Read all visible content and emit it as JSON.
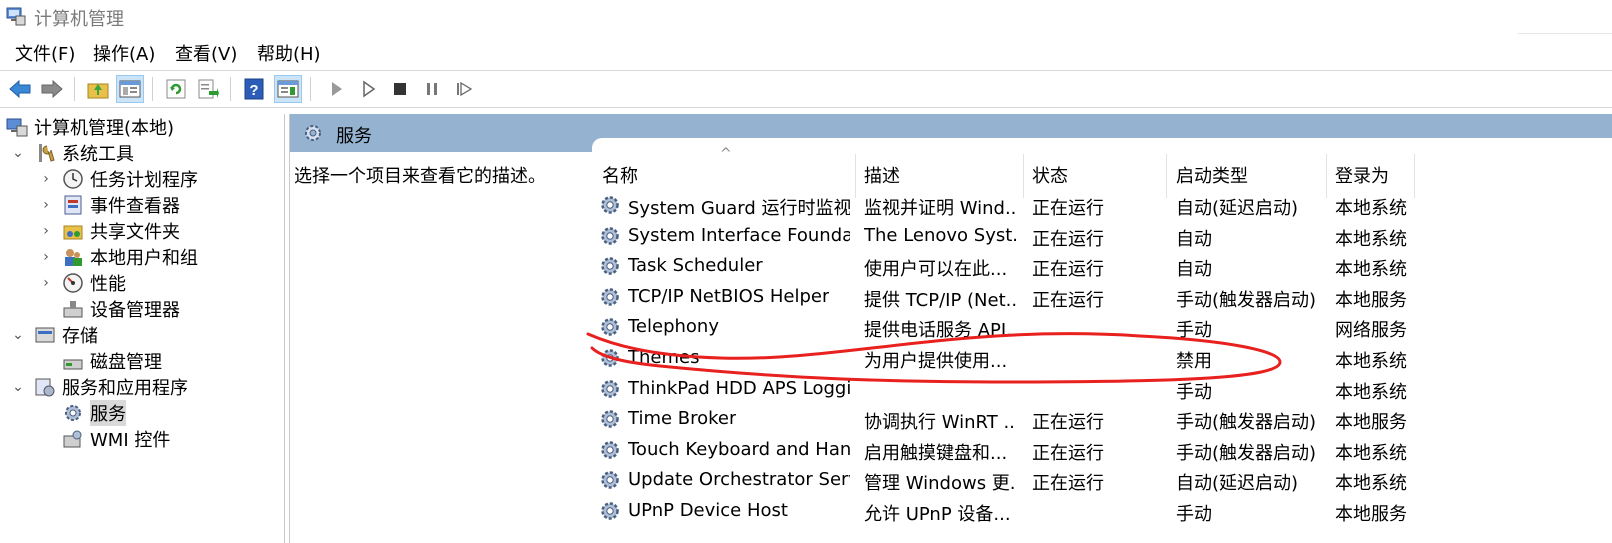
{
  "window": {
    "title": "计算机管理"
  },
  "menu": [
    "文件(F)",
    "操作(A)",
    "查看(V)",
    "帮助(H)"
  ],
  "toolbar": {
    "buttons": [
      "back-icon",
      "forward-icon",
      "up-folder-icon",
      "show-hide-tree-icon",
      "refresh-icon",
      "export-list-icon",
      "help-icon",
      "show-action-pane-icon",
      "start-icon",
      "start-outline-icon",
      "stop-icon",
      "pause-icon",
      "restart-icon"
    ]
  },
  "tree": {
    "root": "计算机管理(本地)",
    "system_tools": "系统工具",
    "task_scheduler": "任务计划程序",
    "event_viewer": "事件查看器",
    "shared_folders": "共享文件夹",
    "local_users": "本地用户和组",
    "performance": "性能",
    "device_manager": "设备管理器",
    "storage": "存储",
    "disk_management": "磁盘管理",
    "services_apps": "服务和应用程序",
    "services": "服务",
    "wmi": "WMI 控件"
  },
  "pane": {
    "title": "服务",
    "description_hint": "选择一个项目来查看它的描述。"
  },
  "columns": {
    "name": "名称",
    "description": "描述",
    "status": "状态",
    "startup_type": "启动类型",
    "log_on_as": "登录为"
  },
  "sort_indicator": "^",
  "services": [
    {
      "name": "System Guard 运行时监视...",
      "desc": "监视并证明 Wind...",
      "status": "正在运行",
      "startup": "自动(延迟启动)",
      "logon": "本地系统"
    },
    {
      "name": "System Interface Foundati...",
      "desc": "The Lenovo Syst...",
      "status": "正在运行",
      "startup": "自动",
      "logon": "本地系统"
    },
    {
      "name": "Task Scheduler",
      "desc": "使用户可以在此...",
      "status": "正在运行",
      "startup": "自动",
      "logon": "本地系统"
    },
    {
      "name": "TCP/IP NetBIOS Helper",
      "desc": "提供 TCP/IP (Net...",
      "status": "正在运行",
      "startup": "手动(触发器启动)",
      "logon": "本地服务"
    },
    {
      "name": "Telephony",
      "desc": "提供电话服务 API...",
      "status": "",
      "startup": "手动",
      "logon": "网络服务"
    },
    {
      "name": "Themes",
      "desc": "为用户提供使用...",
      "status": "",
      "startup": "禁用",
      "logon": "本地系统"
    },
    {
      "name": "ThinkPad HDD APS Loggin...",
      "desc": "",
      "status": "",
      "startup": "手动",
      "logon": "本地系统"
    },
    {
      "name": "Time Broker",
      "desc": "协调执行 WinRT ...",
      "status": "正在运行",
      "startup": "手动(触发器启动)",
      "logon": "本地服务"
    },
    {
      "name": "Touch Keyboard and Hand...",
      "desc": "启用触摸键盘和...",
      "status": "正在运行",
      "startup": "手动(触发器启动)",
      "logon": "本地系统"
    },
    {
      "name": "Update Orchestrator Service",
      "desc": "管理 Windows 更...",
      "status": "正在运行",
      "startup": "自动(延迟启动)",
      "logon": "本地系统"
    },
    {
      "name": "UPnP Device Host",
      "desc": "允许 UPnP 设备...",
      "status": "",
      "startup": "手动",
      "logon": "本地服务"
    }
  ],
  "colors": {
    "pane_header": "#95b3d1",
    "annotation": "#e8201e",
    "selection": "#d9d9d9"
  }
}
